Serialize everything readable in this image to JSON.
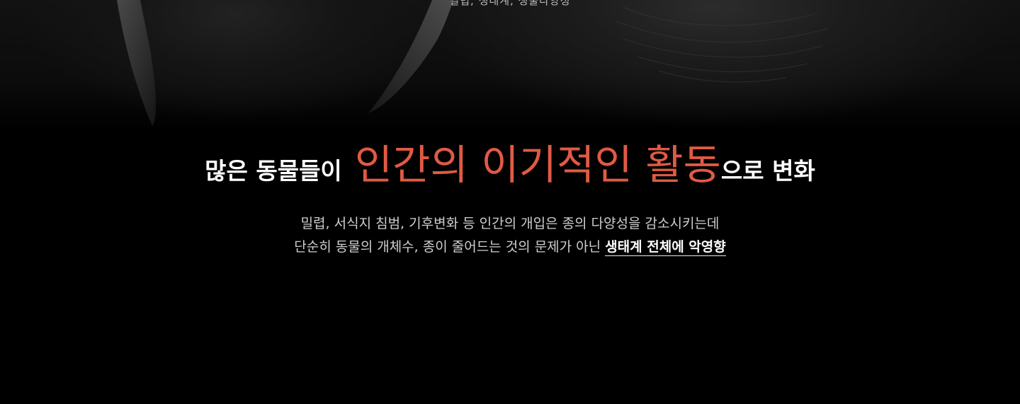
{
  "top_caption": "밀렵, 생태계, 생물다양성",
  "headline": {
    "lead": "많은 동물들이",
    "highlight": "인간의 이기적인 활동",
    "tail": "으로 변화",
    "highlight_color": "#e05a45"
  },
  "body": {
    "line1": "밀렵, 서식지 침범, 기후변화 등 인간의 개입은 종의 다양성을 감소시키는데",
    "line2_prefix": "단순히 동물의 개체수, 종이 줄어드는 것의 문제가 아닌",
    "line2_emphasis": "생태계 전체에 악영향"
  }
}
